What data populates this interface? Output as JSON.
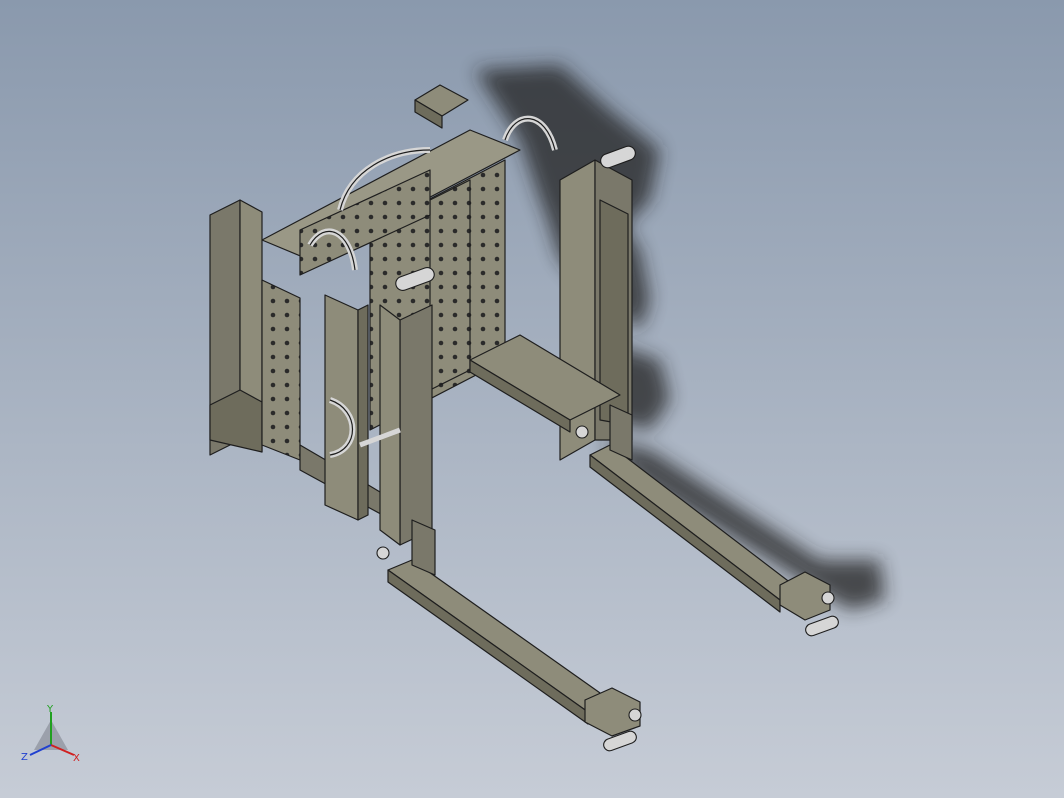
{
  "viewport": {
    "background_top": "#8a99ad",
    "background_bottom": "#c6ccd6"
  },
  "model": {
    "body_color": "#8e8c7a",
    "body_dark": "#6e6c5c",
    "edge_color": "#1e1e1e",
    "shadow_color": "#222222",
    "pin_color": "#d6d6d6"
  },
  "triad": {
    "x_label": "X",
    "y_label": "Y",
    "z_label": "Z",
    "x_color": "#d02020",
    "y_color": "#20a020",
    "z_color": "#2040d0"
  }
}
